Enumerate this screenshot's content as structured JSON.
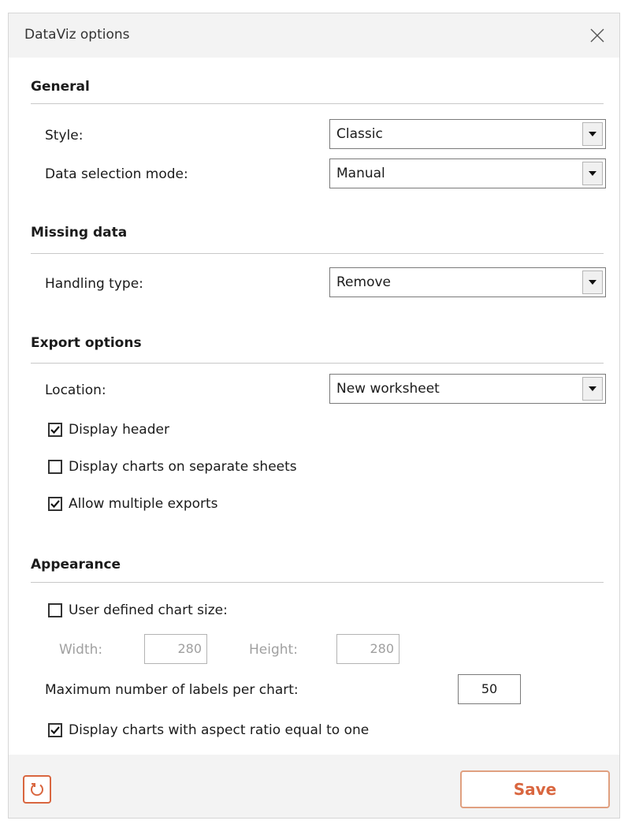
{
  "dialog": {
    "title": "DataViz options"
  },
  "general": {
    "heading": "General",
    "style_label": "Style:",
    "style_value": "Classic",
    "mode_label": "Data selection mode:",
    "mode_value": "Manual"
  },
  "missing": {
    "heading": "Missing data",
    "handling_label": "Handling type:",
    "handling_value": "Remove"
  },
  "export": {
    "heading": "Export options",
    "location_label": "Location:",
    "location_value": "New worksheet",
    "checks": [
      {
        "label": "Display header",
        "checked": true
      },
      {
        "label": "Display charts on separate sheets",
        "checked": false
      },
      {
        "label": "Allow multiple exports",
        "checked": true
      }
    ]
  },
  "appearance": {
    "heading": "Appearance",
    "user_size": {
      "label": "User defined chart size:",
      "checked": false
    },
    "width_label": "Width:",
    "width_value": "280",
    "height_label": "Height:",
    "height_value": "280",
    "max_labels_label": "Maximum number of labels per chart:",
    "max_labels_value": "50",
    "aspect": {
      "label": "Display charts with aspect ratio equal to one",
      "checked": true
    }
  },
  "footer": {
    "save_label": "Save"
  },
  "colors": {
    "accent": "#d9663f",
    "save_border": "#e0a080"
  },
  "icons": {
    "close": "close-icon",
    "reset": "reset-icon",
    "dropdown": "chevron-down-icon",
    "check": "checkmark-icon"
  }
}
